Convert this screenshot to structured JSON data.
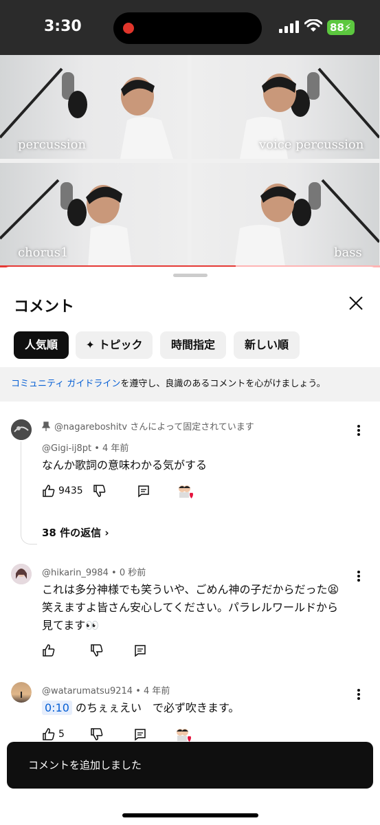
{
  "status_bar": {
    "time": "3:30",
    "battery": "88"
  },
  "video": {
    "tiles": [
      {
        "label": "percussion"
      },
      {
        "label": "voice percussion"
      },
      {
        "label": "chorus1"
      },
      {
        "label": "bass"
      }
    ],
    "progress": 0.62
  },
  "sheet": {
    "title": "コメント",
    "chips": [
      "人気順",
      "トピック",
      "時間指定",
      "新しい順"
    ],
    "guide_link": "コミュニティ ガイドライン",
    "guide_rest": "を遵守し、良識のあるコメントを心がけましょう。"
  },
  "comments": [
    {
      "pinned_text": "@nagareboshitv さんによって固定されています",
      "author": "@Gigi-ij8pt",
      "time": "4 年前",
      "text": "なんか歌詞の意味わかる気がする",
      "likes": "9435",
      "replies": "38 件の返信"
    },
    {
      "author": "@hikarin_9984",
      "time": "0 秒前",
      "text_lines": [
        "これは多分神様でも笑ういや、ごめん神の子だからだった😫",
        "笑えますよ皆さん安心してください。パラレルワールドから",
        "見てます👀"
      ]
    },
    {
      "author": "@watarumatsu9214",
      "time": "4 年前",
      "timestamp": "0:10",
      "text": " のちぇぇえい　で必ず吹きます。",
      "likes": "5"
    }
  ],
  "toast": "コメントを追加しました",
  "colors": {
    "accent_link": "#065fd4",
    "progress": "#e53935",
    "heart": "#e5143e"
  }
}
